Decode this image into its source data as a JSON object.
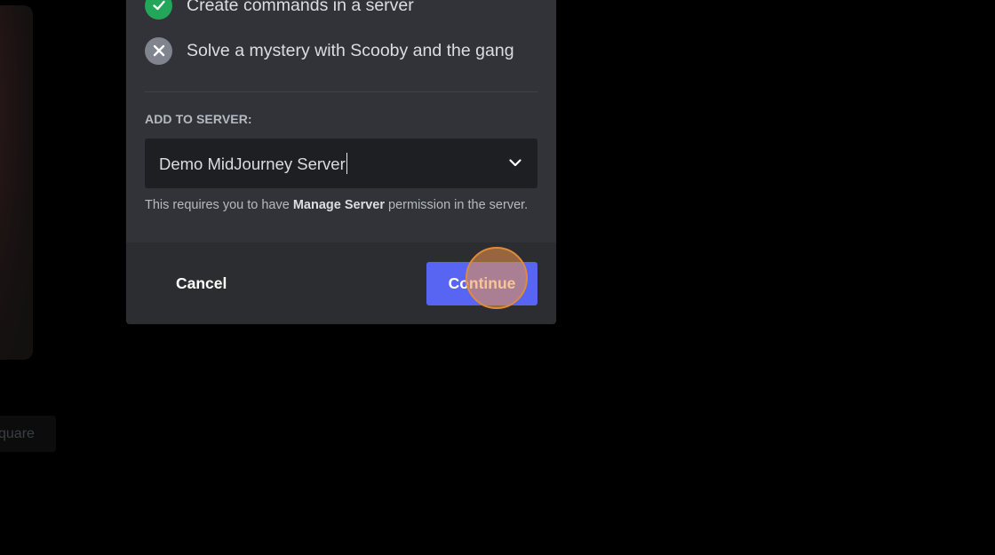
{
  "modal": {
    "permissions": [
      {
        "label": "Create commands in a server",
        "status": "granted",
        "icon": "check-icon"
      },
      {
        "label": "Solve a mystery with Scooby and the gang",
        "status": "denied",
        "icon": "x-icon"
      }
    ],
    "add_to_server_label": "ADD TO SERVER:",
    "server_select": {
      "value": "Demo MidJourney Server",
      "icon": "chevron-down-icon"
    },
    "note": {
      "prefix": "This requires you to have ",
      "emphasis": "Manage Server",
      "suffix": " permission in the server."
    },
    "footer": {
      "cancel_label": "Cancel",
      "continue_label": "Continue"
    }
  },
  "background": {
    "chip_text": "quare"
  },
  "colors": {
    "backdrop": "#000000",
    "modal_bg": "#313338",
    "footer_bg": "#2b2d31",
    "input_bg": "#1e1f22",
    "primary_button": "#5865f2",
    "granted": "#23a55a",
    "denied": "#80848e",
    "click_indicator": "#e08a3c"
  }
}
